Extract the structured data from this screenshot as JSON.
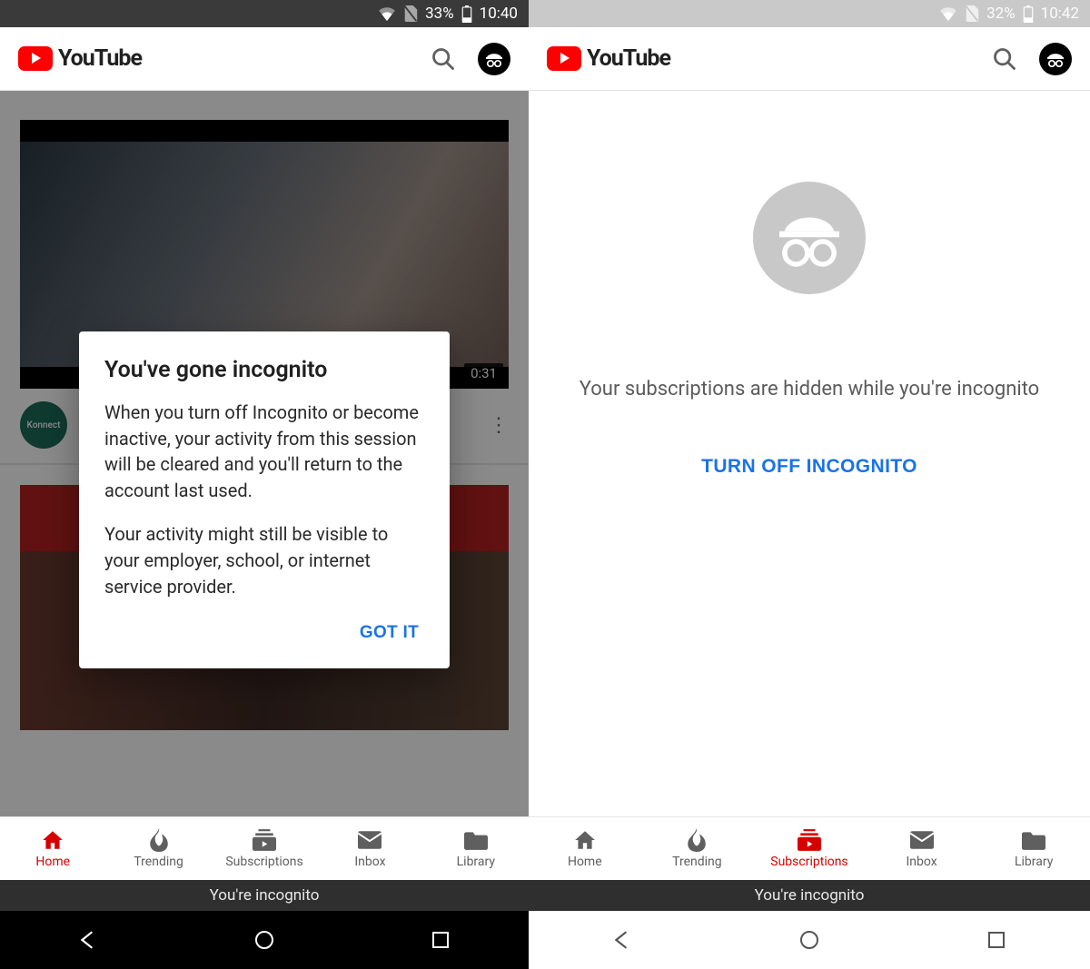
{
  "left": {
    "status": {
      "battery_pct": "33%",
      "time": "10:40"
    },
    "brand": "YouTube",
    "video1": {
      "duration": "0:31",
      "channel_avatar_text": "Konnect"
    },
    "dialog": {
      "title": "You've gone incognito",
      "body1": "When you turn off Incognito or become inactive, your activity from this session will be cleared and you'll return to the account last used.",
      "body2": "Your activity might still be visible to your employer, school, or internet service provider.",
      "confirm": "GOT IT"
    },
    "tabs": [
      {
        "label": "Home",
        "icon": "home",
        "active": true
      },
      {
        "label": "Trending",
        "icon": "flame",
        "active": false
      },
      {
        "label": "Subscriptions",
        "icon": "subs",
        "active": false
      },
      {
        "label": "Inbox",
        "icon": "mail",
        "active": false
      },
      {
        "label": "Library",
        "icon": "folder",
        "active": false
      }
    ],
    "incognito_strip": "You're incognito"
  },
  "right": {
    "status": {
      "battery_pct": "32%",
      "time": "10:42"
    },
    "brand": "YouTube",
    "subs_message": "Your subscriptions are hidden while you're incognito",
    "turn_off": "TURN OFF INCOGNITO",
    "tabs": [
      {
        "label": "Home",
        "icon": "home",
        "active": false
      },
      {
        "label": "Trending",
        "icon": "flame",
        "active": false
      },
      {
        "label": "Subscriptions",
        "icon": "subs",
        "active": true
      },
      {
        "label": "Inbox",
        "icon": "mail",
        "active": false
      },
      {
        "label": "Library",
        "icon": "folder",
        "active": false
      }
    ],
    "incognito_strip": "You're incognito"
  }
}
